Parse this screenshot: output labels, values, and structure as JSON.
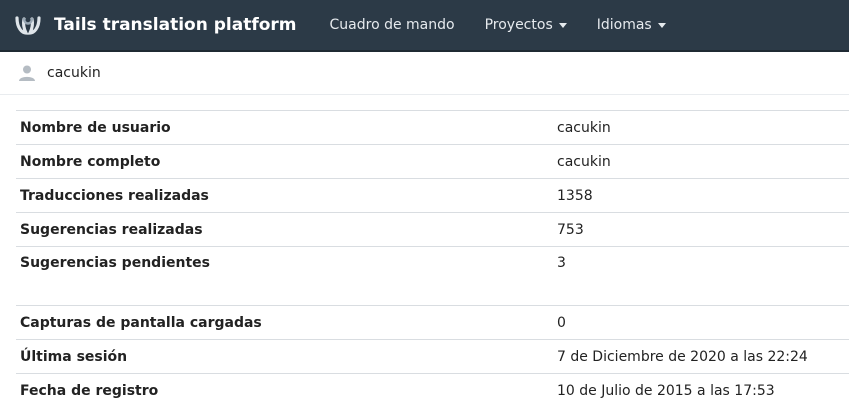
{
  "navbar": {
    "brand": "Tails translation platform",
    "dashboard": "Cuadro de mando",
    "projects": "Proyectos",
    "languages": "Idiomas"
  },
  "user": {
    "username": "cacukin"
  },
  "rows": [
    {
      "label": "Nombre de usuario",
      "value": "cacukin"
    },
    {
      "label": "Nombre completo",
      "value": "cacukin"
    },
    {
      "label": "Traducciones realizadas",
      "value": "1358"
    },
    {
      "label": "Sugerencias realizadas",
      "value": "753"
    },
    {
      "label": "Sugerencias pendientes",
      "value": "3"
    },
    {
      "label": "Capturas de pantalla cargadas",
      "value": "0"
    },
    {
      "label": "Última sesión",
      "value": "7 de Diciembre de 2020 a las 22:24"
    },
    {
      "label": "Fecha de registro",
      "value": "10 de Julio de 2015 a las 17:53"
    }
  ]
}
